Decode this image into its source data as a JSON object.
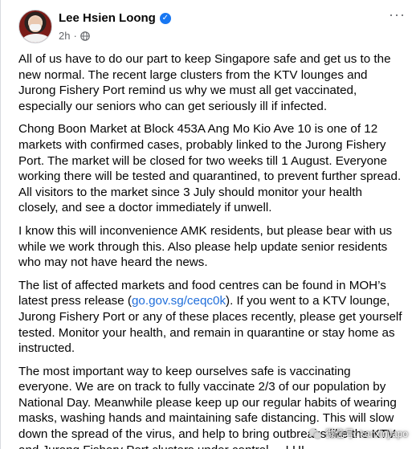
{
  "author": {
    "name": "Lee Hsien Loong",
    "verified_mark": "✓",
    "time": "2h",
    "separator": "·",
    "audience_icon": "globe-icon"
  },
  "more_options": "···",
  "post": {
    "paragraphs": [
      "All of us have to do our part to keep Singapore safe and get us to the new normal. The recent large clusters from the KTV lounges and Jurong Fishery Port remind us why we must all get vaccinated, especially our seniors who can get seriously ill if infected.",
      "Chong Boon Market at Block 453A Ang Mo Kio Ave 10 is one of 12 markets with confirmed cases, probably linked to the Jurong Fishery Port. The market will be closed for two weeks till 1 August. Everyone working there will be tested and quarantined, to prevent further spread. All visitors to the market since 3 July should monitor your health closely, and see a doctor immediately if unwell.",
      "I know this will inconvenience AMK residents, but please bear with us while we work through this. Also please help update senior residents who may not have heard the news."
    ],
    "p4_before": "The list of affected markets and food centres can be found in MOH’s latest press release (",
    "p4_link": "go.gov.sg/ceqc0k",
    "p4_after": "). If you went to a KTV lounge, Jurong Fishery Port or any of these places recently, please get yourself tested. Monitor your health, and remain in quarantine or stay home as instructed.",
    "p5": "The most important way to keep ourselves safe is vaccinating everyone. We are on track to fully vaccinate 2/3 of our population by National Day. Meanwhile please keep up our regular habits of wearing masks, washing hands and maintaining safe distancing. This will slow down the spread of the virus, and help to bring outbreaks like the KTV and Jurong Fishery Port clusters under control. – LHL"
  },
  "watermark": {
    "text": "微信号: kanxinjiapo",
    "icon": "wechat-icon"
  },
  "colors": {
    "link": "#216fdb",
    "verified": "#1877f2",
    "meta": "#65676b"
  }
}
